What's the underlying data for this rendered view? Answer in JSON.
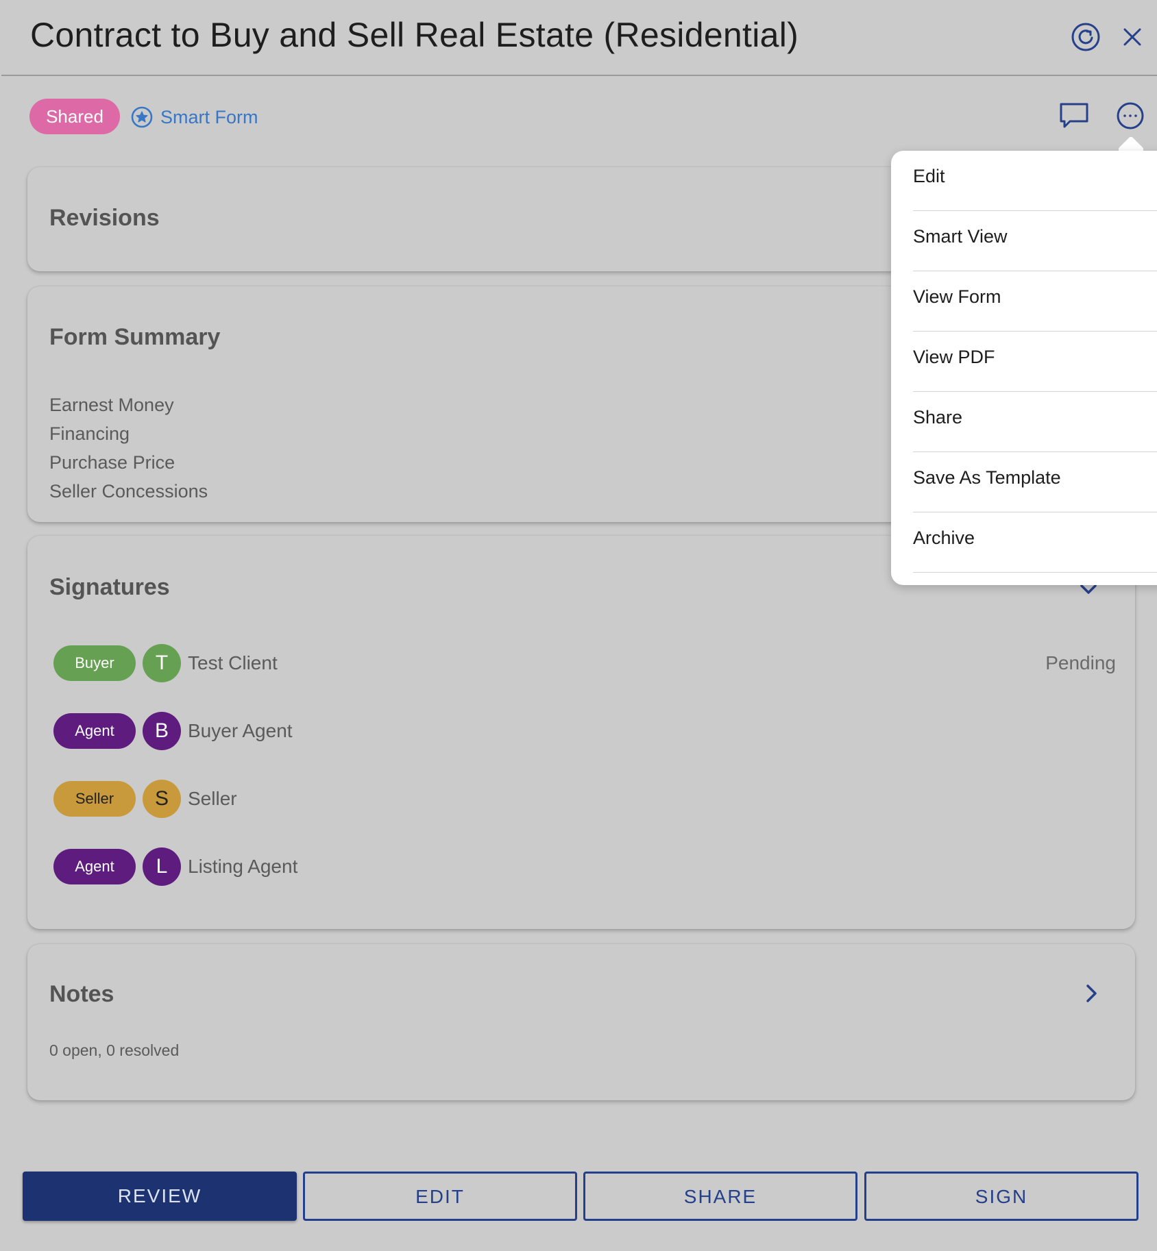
{
  "header": {
    "title": "Contract to Buy and Sell Real Estate (Residential)"
  },
  "subheader": {
    "status_badge": "Shared",
    "smart_form_label": "Smart Form"
  },
  "revisions": {
    "title": "Revisions"
  },
  "form_summary": {
    "title": "Form Summary",
    "items": [
      "Earnest Money",
      "Financing",
      "Purchase Price",
      "Seller Concessions"
    ]
  },
  "signatures": {
    "title": "Signatures",
    "rows": [
      {
        "role": "Buyer",
        "initial": "T",
        "name": "Test Client",
        "status": "Pending"
      },
      {
        "role": "Agent",
        "initial": "B",
        "name": "Buyer Agent",
        "status": ""
      },
      {
        "role": "Seller",
        "initial": "S",
        "name": "Seller",
        "status": ""
      },
      {
        "role": "Agent",
        "initial": "L",
        "name": "Listing Agent",
        "status": ""
      }
    ]
  },
  "notes": {
    "title": "Notes",
    "summary": "0 open, 0 resolved"
  },
  "actions": {
    "review": "REVIEW",
    "edit": "EDIT",
    "share": "SHARE",
    "sign": "SIGN"
  },
  "menu": {
    "items": [
      "Edit",
      "Smart View",
      "View Form",
      "View PDF",
      "Share",
      "Save As Template",
      "Archive"
    ]
  },
  "colors": {
    "shared": "#dd6aa6",
    "buyer": "#66a153",
    "agent": "#5d1c7e",
    "seller": "#c99a3c",
    "primary": "#1c3271",
    "link": "#3777c6"
  },
  "icons": {
    "refresh": "refresh-icon",
    "close": "close-icon",
    "smart_form": "star-badge-icon",
    "comment": "comment-icon",
    "more": "more-options-icon",
    "signatures_toggle": "chevron-down-icon",
    "notes_open": "chevron-right-icon"
  }
}
